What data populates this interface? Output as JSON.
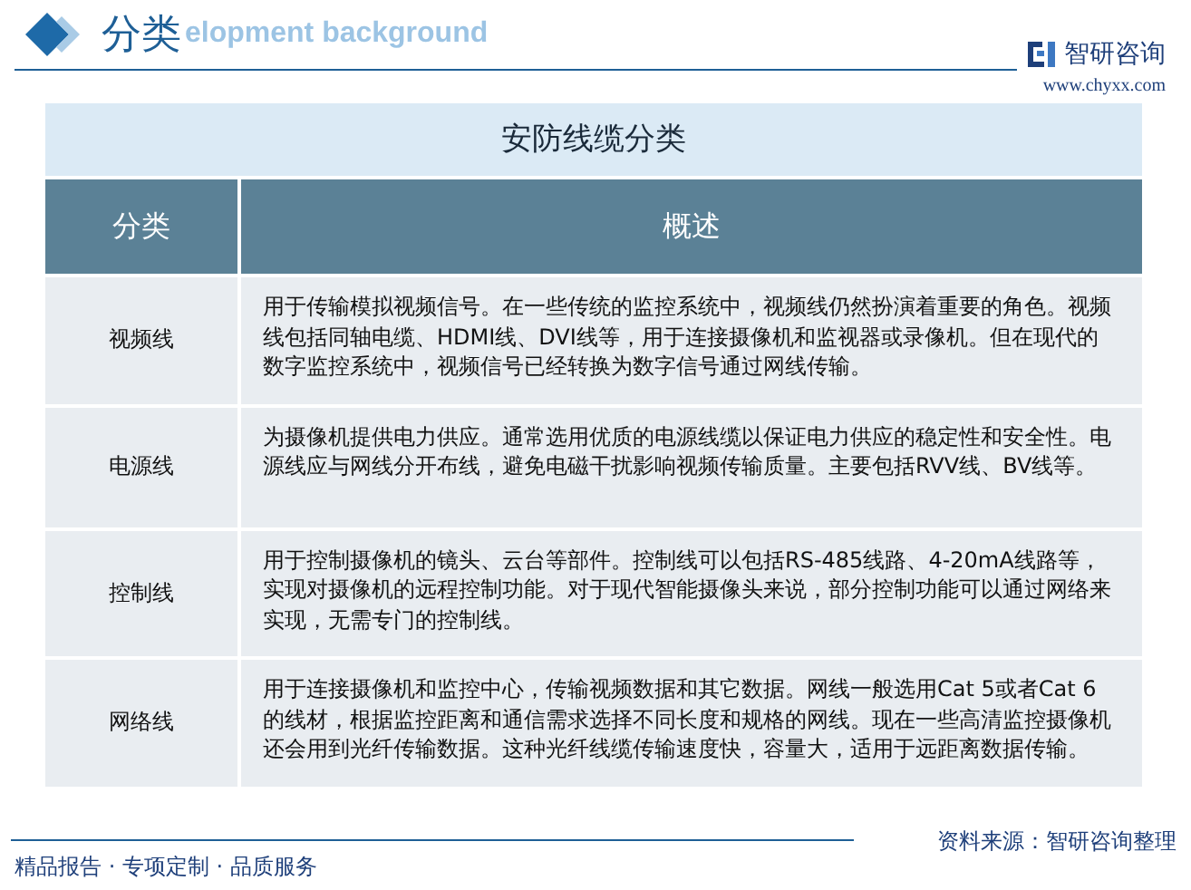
{
  "header": {
    "title": "分类",
    "background_text": "elopment background",
    "logo_name": "智研咨询",
    "logo_url": "www.chyxx.com"
  },
  "table": {
    "caption": "安防线缆分类",
    "columns": [
      "分类",
      "概述"
    ],
    "rows": [
      {
        "category": "视频线",
        "summary": "用于传输模拟视频信号。在一些传统的监控系统中，视频线仍然扮演着重要的角色。视频线包括同轴电缆、HDMI线、DVI线等，用于连接摄像机和监视器或录像机。但在现代的数字监控系统中，视频信号已经转换为数字信号通过网线传输。"
      },
      {
        "category": "电源线",
        "summary": "为摄像机提供电力供应。通常选用优质的电源线缆以保证电力供应的稳定性和安全性。电源线应与网线分开布线，避免电磁干扰影响视频传输质量。主要包括RVV线、BV线等。"
      },
      {
        "category": "控制线",
        "summary": "用于控制摄像机的镜头、云台等部件。控制线可以包括RS-485线路、4-20mA线路等，实现对摄像机的远程控制功能。对于现代智能摄像头来说，部分控制功能可以通过网络来实现，无需专门的控制线。"
      },
      {
        "category": "网络线",
        "summary": "用于连接摄像机和监控中心，传输视频数据和其它数据。网线一般选用Cat 5或者Cat 6的线材，根据监控距离和通信需求选择不同长度和规格的网线。现在一些高清监控摄像机还会用到光纤传输数据。这种光纤线缆传输速度快，容量大，适用于远距离数据传输。"
      }
    ]
  },
  "footer": {
    "slogan": "精品报告 · 专项定制 · 品质服务",
    "source": "资料来源：智研咨询整理"
  }
}
